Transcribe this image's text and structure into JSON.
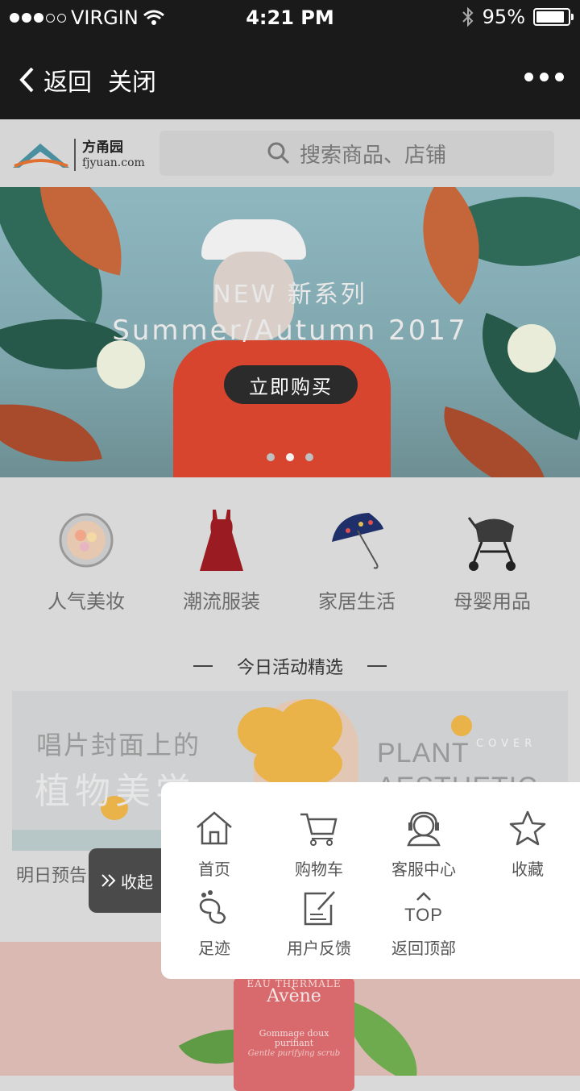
{
  "status": {
    "carrier": "VIRGIN",
    "time": "4:21 PM",
    "battery": "95%"
  },
  "nav": {
    "back": "返回",
    "close": "关闭"
  },
  "header": {
    "logo_brand": "方甬园",
    "logo_url": "fjyuan.com",
    "search_placeholder": "搜索商品、店铺"
  },
  "banner": {
    "line1": "NEW 新系列",
    "line2": "Summer/Autumn 2017",
    "button": "立即购买",
    "pages": 3,
    "active_page": 2
  },
  "categories": [
    {
      "label": "人气美妆",
      "icon": "compact-powder-icon"
    },
    {
      "label": "潮流服装",
      "icon": "red-dress-icon"
    },
    {
      "label": "家居生活",
      "icon": "umbrella-icon"
    },
    {
      "label": "母婴用品",
      "icon": "stroller-icon"
    }
  ],
  "section": {
    "title": "今日活动精选"
  },
  "activity": {
    "line1": "唱片封面上的",
    "line2": "植物美学",
    "plant": "PLANT",
    "cover": "COVER",
    "aesthetic": "AESTHETIC"
  },
  "preview": {
    "text": "明日预告 | 品牌"
  },
  "collapse": {
    "label": "收起"
  },
  "product": {
    "brand_small": "EAU THERMALE",
    "brand": "Avène",
    "line1": "Gommage doux",
    "line2": "purifiant",
    "line3": "Gentle purifying scrub"
  },
  "menu": {
    "items": [
      {
        "label": "首页",
        "icon": "home-icon"
      },
      {
        "label": "购物车",
        "icon": "cart-icon"
      },
      {
        "label": "客服中心",
        "icon": "headset-icon"
      },
      {
        "label": "收藏",
        "icon": "star-icon"
      },
      {
        "label": "足迹",
        "icon": "footprint-icon"
      },
      {
        "label": "用户反馈",
        "icon": "feedback-icon"
      },
      {
        "label": "返回顶部",
        "icon": "top-icon"
      }
    ]
  },
  "colors": {
    "bar": "#1a1a1a",
    "button": "#2b2b2b",
    "menu_bg": "#ffffff"
  }
}
